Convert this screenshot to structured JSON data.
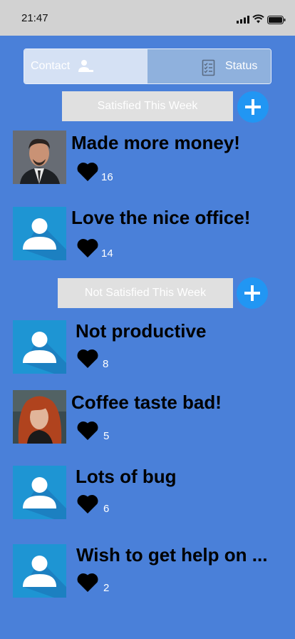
{
  "status_bar": {
    "time": "21:47"
  },
  "tabs": {
    "contact_label": "Contact",
    "status_label": "Status"
  },
  "satisfied": {
    "header": "Satisfied This Week",
    "items": [
      {
        "title": "Made more money!",
        "likes": "16",
        "avatar": "photo-man"
      },
      {
        "title": "Love the nice office!",
        "likes": "14",
        "avatar": "default-user"
      }
    ]
  },
  "not_satisfied": {
    "header": "Not Satisfied This Week",
    "items": [
      {
        "title": "Not productive",
        "likes": "8",
        "avatar": "default-user"
      },
      {
        "title": "Coffee taste bad!",
        "likes": "5",
        "avatar": "photo-woman"
      },
      {
        "title": "Lots of bug",
        "likes": "6",
        "avatar": "default-user"
      },
      {
        "title": "Wish to get help on ...",
        "likes": "2",
        "avatar": "default-user"
      }
    ]
  },
  "colors": {
    "background": "#4a80d9",
    "accent": "#2196f3",
    "avatar_bg": "#1e95d3"
  }
}
